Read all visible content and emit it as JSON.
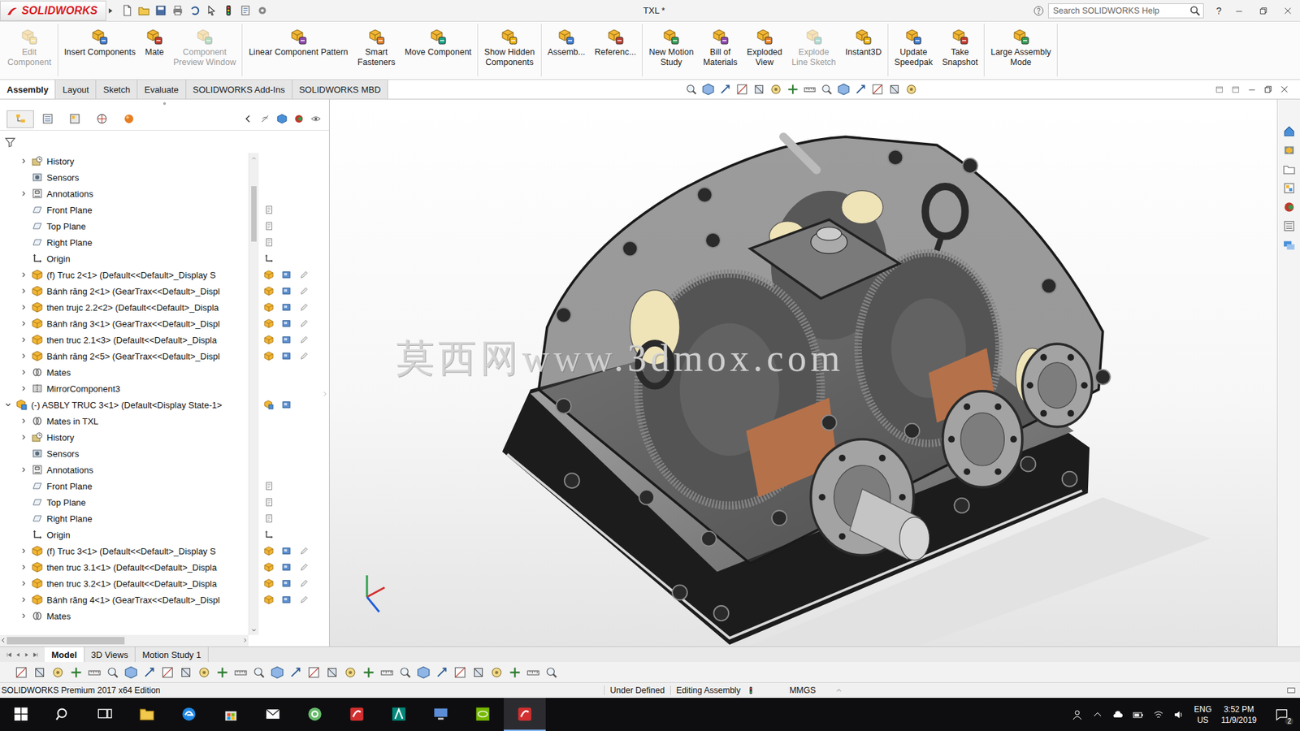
{
  "window": {
    "app": "SOLIDWORKS",
    "title": "TXL *",
    "search_placeholder": "Search SOLIDWORKS Help",
    "help": "?"
  },
  "ribbon": {
    "groups": [
      [
        {
          "lines": [
            "Edit",
            "Component"
          ],
          "disabled": true
        }
      ],
      [
        {
          "lines": [
            "Insert Components"
          ],
          "disabled": false
        },
        {
          "lines": [
            "Mate"
          ],
          "disabled": false
        },
        {
          "lines": [
            "Component",
            "Preview Window"
          ],
          "disabled": true
        }
      ],
      [
        {
          "lines": [
            "Linear Component Pattern"
          ],
          "disabled": false
        },
        {
          "lines": [
            "Smart",
            "Fasteners"
          ],
          "disabled": false
        },
        {
          "lines": [
            "Move Component"
          ],
          "disabled": false
        }
      ],
      [
        {
          "lines": [
            "Show Hidden",
            "Components"
          ],
          "disabled": false
        }
      ],
      [
        {
          "lines": [
            "Assemb..."
          ],
          "disabled": false
        },
        {
          "lines": [
            "Referenc..."
          ],
          "disabled": false
        }
      ],
      [
        {
          "lines": [
            "New Motion",
            "Study"
          ],
          "disabled": false
        },
        {
          "lines": [
            "Bill of",
            "Materials"
          ],
          "disabled": false
        },
        {
          "lines": [
            "Exploded",
            "View"
          ],
          "disabled": false
        },
        {
          "lines": [
            "Explode",
            "Line Sketch"
          ],
          "disabled": true
        },
        {
          "lines": [
            "Instant3D"
          ],
          "disabled": false
        }
      ],
      [
        {
          "lines": [
            "Update",
            "Speedpak"
          ],
          "disabled": false
        },
        {
          "lines": [
            "Take",
            "Snapshot"
          ],
          "disabled": false
        }
      ],
      [
        {
          "lines": [
            "Large Assembly",
            "Mode"
          ],
          "disabled": false
        }
      ]
    ]
  },
  "tabs": [
    {
      "label": "Assembly",
      "selected": true
    },
    {
      "label": "Layout",
      "selected": false
    },
    {
      "label": "Sketch",
      "selected": false
    },
    {
      "label": "Evaluate",
      "selected": false
    },
    {
      "label": "SOLIDWORKS Add-Ins",
      "selected": false
    },
    {
      "label": "SOLIDWORKS MBD",
      "selected": false
    }
  ],
  "tree": {
    "scrollbar": {
      "level": 0.05,
      "thumb": 0.12
    },
    "hscrollbar": {
      "level": 0,
      "thumb": 0.5
    },
    "items": [
      {
        "label": "History",
        "kind": "history",
        "level": 1,
        "expander": true,
        "expanded": false
      },
      {
        "label": "Sensors",
        "kind": "sensor",
        "level": 1,
        "expander": false,
        "expanded": false
      },
      {
        "label": "Annotations",
        "kind": "annotation",
        "level": 1,
        "expander": true,
        "expanded": false
      },
      {
        "label": "Front Plane",
        "kind": "plane",
        "level": 1,
        "expander": false,
        "expanded": false
      },
      {
        "label": "Top Plane",
        "kind": "plane",
        "level": 1,
        "expander": false,
        "expanded": false
      },
      {
        "label": "Right Plane",
        "kind": "plane",
        "level": 1,
        "expander": false,
        "expanded": false
      },
      {
        "label": "Origin",
        "kind": "origin",
        "level": 1,
        "expander": false,
        "expanded": false
      },
      {
        "label": "(f) Truc 2<1> (Default<<Default>_Display S",
        "kind": "part",
        "level": 1,
        "expander": true,
        "expanded": false
      },
      {
        "label": "Bánh răng 2<1> (GearTrax<<Default>_Displ",
        "kind": "part",
        "level": 1,
        "expander": true,
        "expanded": false
      },
      {
        "label": "then trujc 2.2<2> (Default<<Default>_Displa",
        "kind": "part",
        "level": 1,
        "expander": true,
        "expanded": false
      },
      {
        "label": "Bánh răng 3<1> (GearTrax<<Default>_Displ",
        "kind": "part",
        "level": 1,
        "expander": true,
        "expanded": false
      },
      {
        "label": "then truc 2.1<3> (Default<<Default>_Displa",
        "kind": "part",
        "level": 1,
        "expander": true,
        "expanded": false
      },
      {
        "label": "Bánh răng 2<5> (GearTrax<<Default>_Displ",
        "kind": "part",
        "level": 1,
        "expander": true,
        "expanded": false
      },
      {
        "label": "Mates",
        "kind": "mates",
        "level": 1,
        "expander": true,
        "expanded": false
      },
      {
        "label": "MirrorComponent3",
        "kind": "mirror",
        "level": 1,
        "expander": true,
        "expanded": false
      },
      {
        "label": "(-) ASBLY TRUC 3<1> (Default<Display State-1>",
        "kind": "assembly",
        "level": 0,
        "expander": true,
        "expanded": true
      },
      {
        "label": "Mates in TXL",
        "kind": "mates",
        "level": 1,
        "expander": true,
        "expanded": false
      },
      {
        "label": "History",
        "kind": "history",
        "level": 1,
        "expander": true,
        "expanded": false
      },
      {
        "label": "Sensors",
        "kind": "sensor",
        "level": 1,
        "expander": false,
        "expanded": false
      },
      {
        "label": "Annotations",
        "kind": "annotation",
        "level": 1,
        "expander": true,
        "expanded": false
      },
      {
        "label": "Front Plane",
        "kind": "plane",
        "level": 1,
        "expander": false,
        "expanded": false
      },
      {
        "label": "Top Plane",
        "kind": "plane",
        "level": 1,
        "expander": false,
        "expanded": false
      },
      {
        "label": "Right Plane",
        "kind": "plane",
        "level": 1,
        "expander": false,
        "expanded": false
      },
      {
        "label": "Origin",
        "kind": "origin",
        "level": 1,
        "expander": false,
        "expanded": false
      },
      {
        "label": "(f) Truc 3<1> (Default<<Default>_Display S",
        "kind": "part",
        "level": 1,
        "expander": true,
        "expanded": false
      },
      {
        "label": "then truc 3.1<1> (Default<<Default>_Displa",
        "kind": "part",
        "level": 1,
        "expander": true,
        "expanded": false
      },
      {
        "label": "then truc 3.2<1> (Default<<Default>_Displa",
        "kind": "part",
        "level": 1,
        "expander": true,
        "expanded": false
      },
      {
        "label": "Bánh răng 4<1> (GearTrax<<Default>_Displ",
        "kind": "part",
        "level": 1,
        "expander": true,
        "expanded": false
      },
      {
        "label": "Mates",
        "kind": "mates",
        "level": 1,
        "expander": true,
        "expanded": false
      }
    ]
  },
  "watermark": "莫西网www.3dmox.com",
  "bottom_tabs": [
    {
      "label": "Model",
      "selected": true
    },
    {
      "label": "3D Views",
      "selected": false
    },
    {
      "label": "Motion Study 1",
      "selected": false
    }
  ],
  "status_bar": {
    "edition": "SOLIDWORKS Premium 2017 x64 Edition",
    "items": [
      "Under Defined",
      "Editing Assembly"
    ],
    "units": "MMGS"
  },
  "taskbar": {
    "language": "ENG",
    "region": "US",
    "time": "3:52 PM",
    "date": "11/9/2019",
    "notifications": "2"
  }
}
